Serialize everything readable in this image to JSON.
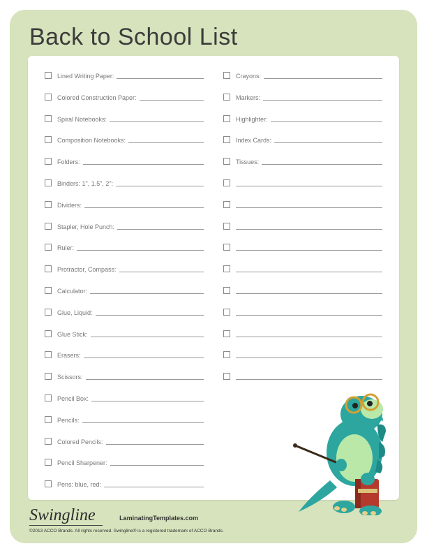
{
  "title": "Back to School List",
  "leftItems": [
    "Lined Writing Paper:",
    "Colored Construction Paper:",
    "Spiral Notebooks:",
    "Composition Notebooks:",
    "Folders:",
    "Binders: 1\", 1.5\", 2\":",
    "Dividers:",
    "Stapler, Hole Punch:",
    "Ruler:",
    "Protractor, Compass:",
    "Calculator:",
    "Glue, Liquid:",
    "Glue Stick:",
    "Erasers:",
    "Scissors:",
    "Pencil Box:",
    "Pencils:",
    "Colored Pencils:",
    "Pencil Sharpener:",
    "Pens: blue, red:"
  ],
  "rightItems": [
    "Crayons:",
    "Markers:",
    "Highlighter:",
    "Index Cards:",
    "Tissues:",
    "",
    "",
    "",
    "",
    "",
    "",
    "",
    "",
    "",
    ""
  ],
  "footer": {
    "brand": "Swingline",
    "site": "LaminatingTemplates.com",
    "copy": "©2013 ACCO Brands. All rights reserved. Swingline® is a registered trademark of ACCO Brands."
  }
}
